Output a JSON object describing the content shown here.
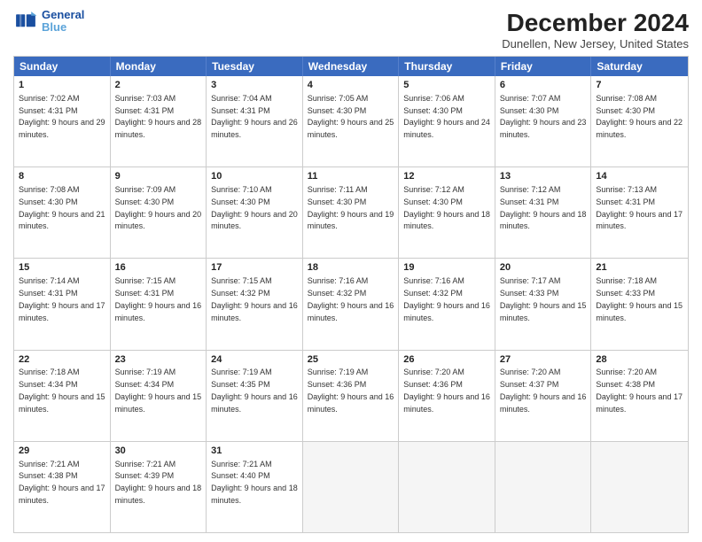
{
  "header": {
    "logo_line1": "General",
    "logo_line2": "Blue",
    "title": "December 2024",
    "subtitle": "Dunellen, New Jersey, United States"
  },
  "days_of_week": [
    "Sunday",
    "Monday",
    "Tuesday",
    "Wednesday",
    "Thursday",
    "Friday",
    "Saturday"
  ],
  "weeks": [
    [
      {
        "day": "1",
        "sunrise": "Sunrise: 7:02 AM",
        "sunset": "Sunset: 4:31 PM",
        "daylight": "Daylight: 9 hours and 29 minutes."
      },
      {
        "day": "2",
        "sunrise": "Sunrise: 7:03 AM",
        "sunset": "Sunset: 4:31 PM",
        "daylight": "Daylight: 9 hours and 28 minutes."
      },
      {
        "day": "3",
        "sunrise": "Sunrise: 7:04 AM",
        "sunset": "Sunset: 4:31 PM",
        "daylight": "Daylight: 9 hours and 26 minutes."
      },
      {
        "day": "4",
        "sunrise": "Sunrise: 7:05 AM",
        "sunset": "Sunset: 4:30 PM",
        "daylight": "Daylight: 9 hours and 25 minutes."
      },
      {
        "day": "5",
        "sunrise": "Sunrise: 7:06 AM",
        "sunset": "Sunset: 4:30 PM",
        "daylight": "Daylight: 9 hours and 24 minutes."
      },
      {
        "day": "6",
        "sunrise": "Sunrise: 7:07 AM",
        "sunset": "Sunset: 4:30 PM",
        "daylight": "Daylight: 9 hours and 23 minutes."
      },
      {
        "day": "7",
        "sunrise": "Sunrise: 7:08 AM",
        "sunset": "Sunset: 4:30 PM",
        "daylight": "Daylight: 9 hours and 22 minutes."
      }
    ],
    [
      {
        "day": "8",
        "sunrise": "Sunrise: 7:08 AM",
        "sunset": "Sunset: 4:30 PM",
        "daylight": "Daylight: 9 hours and 21 minutes."
      },
      {
        "day": "9",
        "sunrise": "Sunrise: 7:09 AM",
        "sunset": "Sunset: 4:30 PM",
        "daylight": "Daylight: 9 hours and 20 minutes."
      },
      {
        "day": "10",
        "sunrise": "Sunrise: 7:10 AM",
        "sunset": "Sunset: 4:30 PM",
        "daylight": "Daylight: 9 hours and 20 minutes."
      },
      {
        "day": "11",
        "sunrise": "Sunrise: 7:11 AM",
        "sunset": "Sunset: 4:30 PM",
        "daylight": "Daylight: 9 hours and 19 minutes."
      },
      {
        "day": "12",
        "sunrise": "Sunrise: 7:12 AM",
        "sunset": "Sunset: 4:30 PM",
        "daylight": "Daylight: 9 hours and 18 minutes."
      },
      {
        "day": "13",
        "sunrise": "Sunrise: 7:12 AM",
        "sunset": "Sunset: 4:31 PM",
        "daylight": "Daylight: 9 hours and 18 minutes."
      },
      {
        "day": "14",
        "sunrise": "Sunrise: 7:13 AM",
        "sunset": "Sunset: 4:31 PM",
        "daylight": "Daylight: 9 hours and 17 minutes."
      }
    ],
    [
      {
        "day": "15",
        "sunrise": "Sunrise: 7:14 AM",
        "sunset": "Sunset: 4:31 PM",
        "daylight": "Daylight: 9 hours and 17 minutes."
      },
      {
        "day": "16",
        "sunrise": "Sunrise: 7:15 AM",
        "sunset": "Sunset: 4:31 PM",
        "daylight": "Daylight: 9 hours and 16 minutes."
      },
      {
        "day": "17",
        "sunrise": "Sunrise: 7:15 AM",
        "sunset": "Sunset: 4:32 PM",
        "daylight": "Daylight: 9 hours and 16 minutes."
      },
      {
        "day": "18",
        "sunrise": "Sunrise: 7:16 AM",
        "sunset": "Sunset: 4:32 PM",
        "daylight": "Daylight: 9 hours and 16 minutes."
      },
      {
        "day": "19",
        "sunrise": "Sunrise: 7:16 AM",
        "sunset": "Sunset: 4:32 PM",
        "daylight": "Daylight: 9 hours and 16 minutes."
      },
      {
        "day": "20",
        "sunrise": "Sunrise: 7:17 AM",
        "sunset": "Sunset: 4:33 PM",
        "daylight": "Daylight: 9 hours and 15 minutes."
      },
      {
        "day": "21",
        "sunrise": "Sunrise: 7:18 AM",
        "sunset": "Sunset: 4:33 PM",
        "daylight": "Daylight: 9 hours and 15 minutes."
      }
    ],
    [
      {
        "day": "22",
        "sunrise": "Sunrise: 7:18 AM",
        "sunset": "Sunset: 4:34 PM",
        "daylight": "Daylight: 9 hours and 15 minutes."
      },
      {
        "day": "23",
        "sunrise": "Sunrise: 7:19 AM",
        "sunset": "Sunset: 4:34 PM",
        "daylight": "Daylight: 9 hours and 15 minutes."
      },
      {
        "day": "24",
        "sunrise": "Sunrise: 7:19 AM",
        "sunset": "Sunset: 4:35 PM",
        "daylight": "Daylight: 9 hours and 16 minutes."
      },
      {
        "day": "25",
        "sunrise": "Sunrise: 7:19 AM",
        "sunset": "Sunset: 4:36 PM",
        "daylight": "Daylight: 9 hours and 16 minutes."
      },
      {
        "day": "26",
        "sunrise": "Sunrise: 7:20 AM",
        "sunset": "Sunset: 4:36 PM",
        "daylight": "Daylight: 9 hours and 16 minutes."
      },
      {
        "day": "27",
        "sunrise": "Sunrise: 7:20 AM",
        "sunset": "Sunset: 4:37 PM",
        "daylight": "Daylight: 9 hours and 16 minutes."
      },
      {
        "day": "28",
        "sunrise": "Sunrise: 7:20 AM",
        "sunset": "Sunset: 4:38 PM",
        "daylight": "Daylight: 9 hours and 17 minutes."
      }
    ],
    [
      {
        "day": "29",
        "sunrise": "Sunrise: 7:21 AM",
        "sunset": "Sunset: 4:38 PM",
        "daylight": "Daylight: 9 hours and 17 minutes."
      },
      {
        "day": "30",
        "sunrise": "Sunrise: 7:21 AM",
        "sunset": "Sunset: 4:39 PM",
        "daylight": "Daylight: 9 hours and 18 minutes."
      },
      {
        "day": "31",
        "sunrise": "Sunrise: 7:21 AM",
        "sunset": "Sunset: 4:40 PM",
        "daylight": "Daylight: 9 hours and 18 minutes."
      },
      null,
      null,
      null,
      null
    ]
  ]
}
